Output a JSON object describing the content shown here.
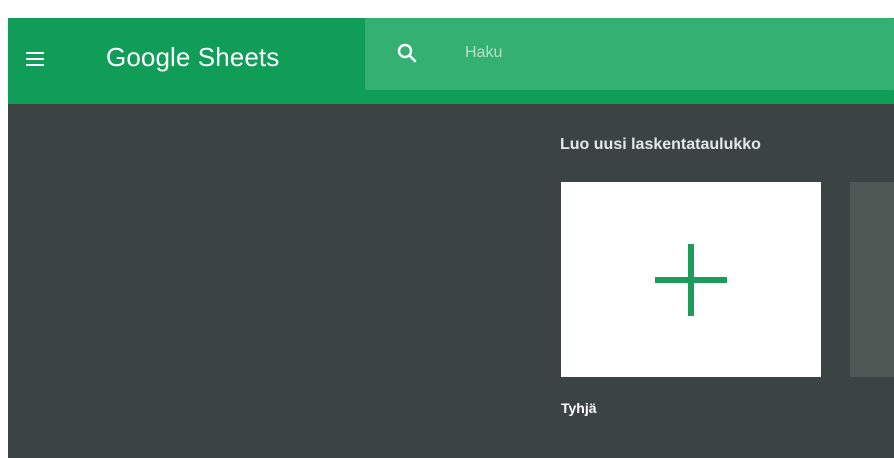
{
  "app": {
    "title": "Google Sheets"
  },
  "header": {
    "menu_icon": "hamburger-menu-icon",
    "search_icon": "search-icon"
  },
  "search": {
    "placeholder": "Haku",
    "value": ""
  },
  "templates": {
    "section_title": "Luo uusi laskentataulukko",
    "items": [
      {
        "label": "Tyhjä",
        "icon": "plus-icon"
      }
    ]
  },
  "colors": {
    "header_bg": "#0f9d58",
    "search_bg": "#33b072",
    "body_bg": "#3b4443",
    "card_bg": "#ffffff",
    "plus_color": "#1e9c5b",
    "partial_card_bg": "#4f5755"
  }
}
